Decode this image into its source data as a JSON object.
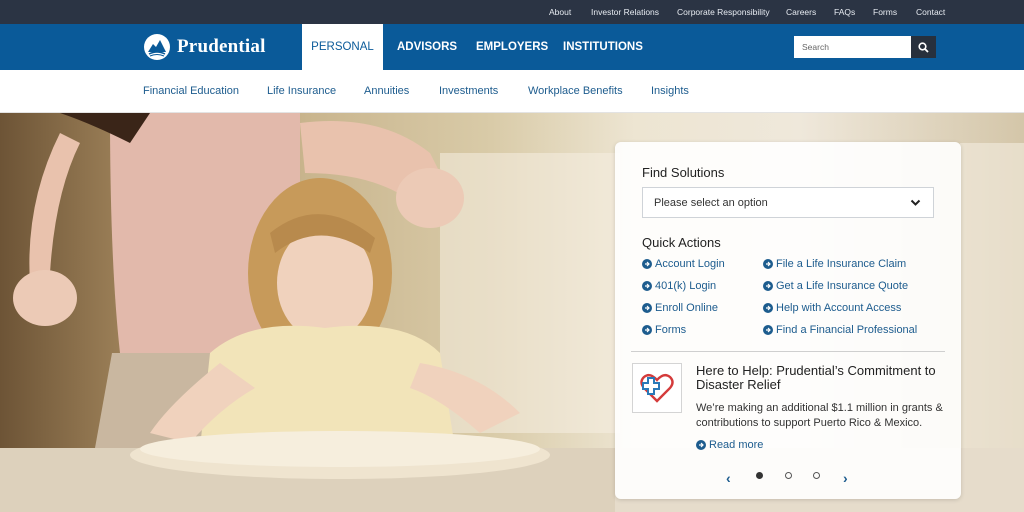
{
  "utility_nav": [
    "About",
    "Investor Relations",
    "Corporate Responsibility",
    "Careers",
    "FAQs",
    "Forms",
    "Contact"
  ],
  "brand": {
    "name": "Prudential",
    "primary_color": "#0a5a99",
    "utility_bg": "#2b3444"
  },
  "main_nav": [
    "PERSONAL",
    "ADVISORS",
    "EMPLOYERS",
    "INSTITUTIONS"
  ],
  "active_tab": "PERSONAL",
  "search": {
    "placeholder": "Search",
    "icon": "search-icon"
  },
  "sub_nav": [
    "Financial Education",
    "Life Insurance",
    "Annuities",
    "Investments",
    "Workplace Benefits",
    "Insights"
  ],
  "panel": {
    "find_title": "Find Solutions",
    "select_value": "Please select an option",
    "quick_title": "Quick Actions",
    "quick_left": [
      "Account Login",
      "401(k) Login",
      "Enroll Online",
      "Forms"
    ],
    "quick_right": [
      "File a Life Insurance Claim",
      "Get a Life Insurance Quote",
      "Help with Account Access",
      "Find a Financial Professional"
    ],
    "news": {
      "title": "Here to Help: Prudential’s Commitment to Disaster Relief",
      "body": "We’re making an additional $1.1 million in grants & contributions to support Puerto Rico & Mexico.",
      "read_more": "Read more",
      "icon": "heart-cross-icon"
    },
    "carousel": {
      "slides": 3,
      "active": 1,
      "prev": "‹",
      "next": "›"
    }
  }
}
